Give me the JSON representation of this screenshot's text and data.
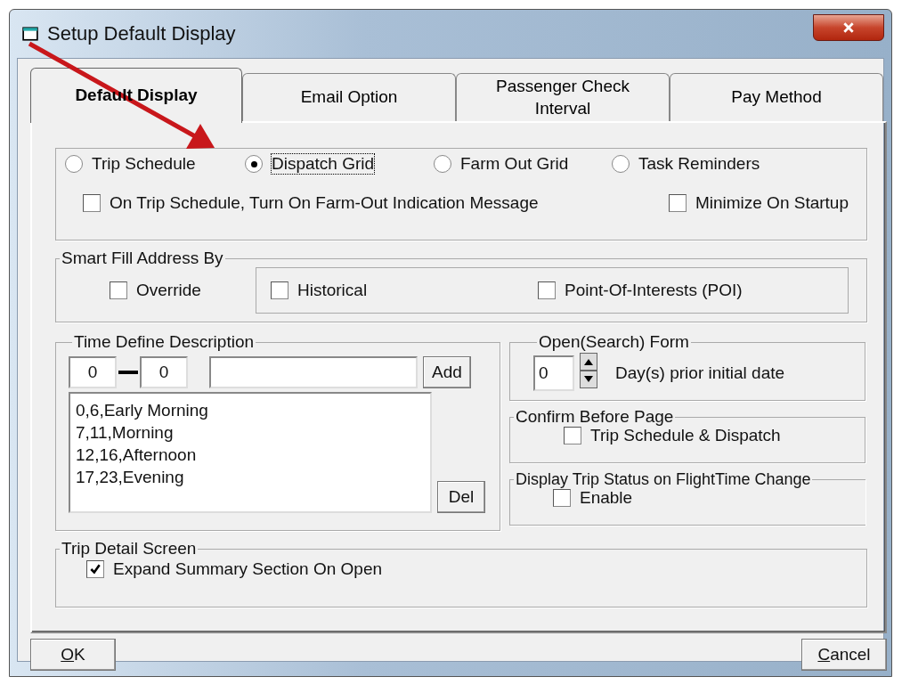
{
  "window": {
    "title": "Setup Default Display"
  },
  "tabs": [
    {
      "label": "Default Display",
      "selected": true
    },
    {
      "label": "Email Option",
      "selected": false
    },
    {
      "label": "Passenger Check Interval",
      "selected": false
    },
    {
      "label": "Pay Method",
      "selected": false
    }
  ],
  "default_view": {
    "options": [
      {
        "label": "Trip Schedule",
        "selected": false,
        "focused": false
      },
      {
        "label": "Dispatch Grid",
        "selected": true,
        "focused": true
      },
      {
        "label": "Farm Out Grid",
        "selected": false,
        "focused": false
      },
      {
        "label": "Task Reminders",
        "selected": false,
        "focused": false
      }
    ],
    "checkboxes": [
      {
        "label": "On Trip Schedule, Turn On Farm-Out Indication Message",
        "checked": false
      },
      {
        "label": "Minimize On Startup",
        "checked": false
      }
    ]
  },
  "smart_fill": {
    "title": "Smart Fill Address By",
    "override": {
      "label": "Override",
      "checked": false
    },
    "options": [
      {
        "label": "Historical",
        "checked": false
      },
      {
        "label": "Point-Of-Interests (POI)",
        "checked": false
      }
    ]
  },
  "time_define": {
    "title": "Time Define Description",
    "from_value": "0",
    "to_value": "0",
    "add_button": "Add",
    "del_button": "Del",
    "entries": [
      "0,6,Early Morning",
      "7,11,Morning",
      "12,16,Afternoon",
      "17,23,Evening"
    ]
  },
  "open_search": {
    "title": "Open(Search) Form",
    "value": "0",
    "label": "Day(s) prior initial date"
  },
  "confirm_before_page": {
    "title": "Confirm Before Page",
    "checkbox": {
      "label": "Trip Schedule & Dispatch",
      "checked": false
    }
  },
  "display_trip_status": {
    "title": "Display Trip Status on FlightTime Change",
    "checkbox": {
      "label": "Enable",
      "checked": false
    }
  },
  "trip_detail": {
    "title": "Trip Detail Screen",
    "checkbox": {
      "label": "Expand Summary Section On Open",
      "checked": true
    }
  },
  "buttons": [
    {
      "label": "OK",
      "mnemonic_first": true
    },
    {
      "label": "Cancel",
      "mnemonic_first": true
    }
  ]
}
